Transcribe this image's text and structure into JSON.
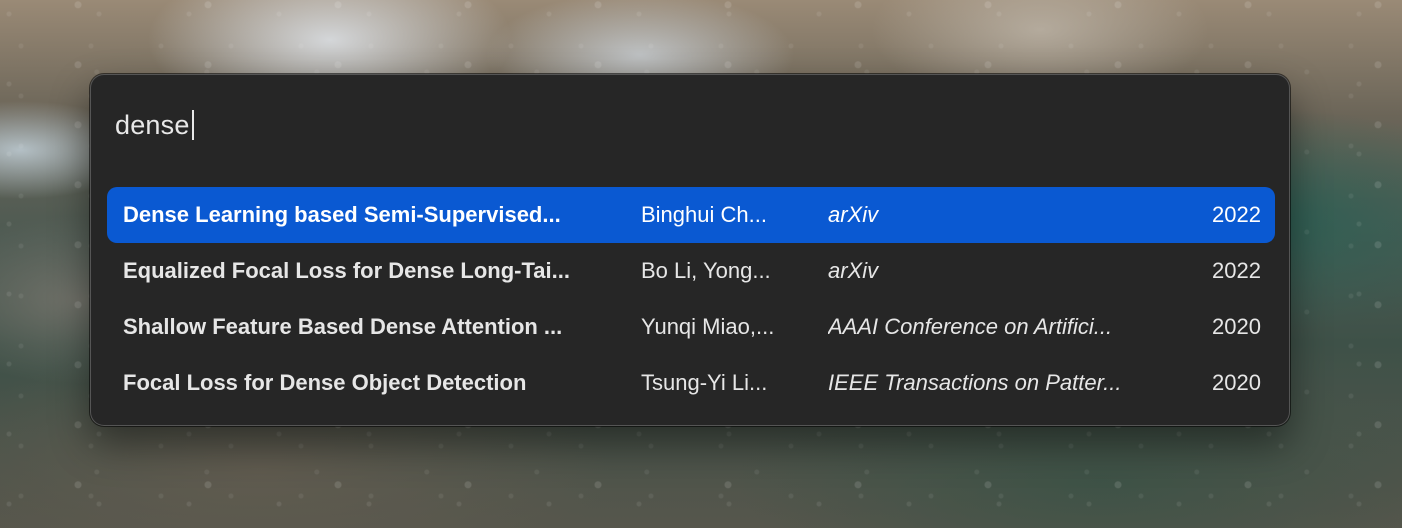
{
  "search": {
    "query": "dense"
  },
  "results": [
    {
      "title": "Dense Learning based Semi-Supervised...",
      "authors": "Binghui Ch...",
      "venue": "arXiv",
      "year": "2022",
      "selected": true
    },
    {
      "title": "Equalized Focal Loss for Dense Long-Tai...",
      "authors": "Bo Li, Yong...",
      "venue": "arXiv",
      "year": "2022",
      "selected": false
    },
    {
      "title": "Shallow Feature Based Dense Attention ...",
      "authors": "Yunqi Miao,...",
      "venue": "AAAI Conference on Artifici...",
      "year": "2020",
      "selected": false
    },
    {
      "title": "Focal Loss for Dense Object Detection",
      "authors": "Tsung-Yi Li...",
      "venue": "IEEE Transactions on Patter...",
      "year": "2020",
      "selected": false
    }
  ],
  "colors": {
    "panel_background": "#262626",
    "selection": "#0a59d2",
    "text": "#e6e6e6"
  }
}
